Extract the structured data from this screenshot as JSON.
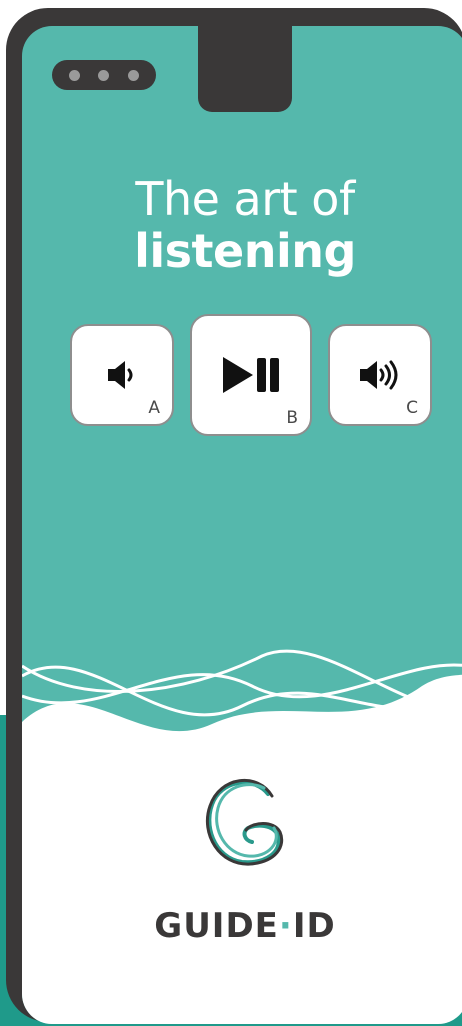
{
  "headline": {
    "line1": "The art of",
    "line2": "listening"
  },
  "controls": [
    {
      "id": "A",
      "icon": "volume-low-icon",
      "letter": "A"
    },
    {
      "id": "B",
      "icon": "play-pause-icon",
      "letter": "B"
    },
    {
      "id": "C",
      "icon": "volume-high-icon",
      "letter": "C"
    }
  ],
  "brand": {
    "name_left": "GUIDE",
    "separator": "·",
    "name_right": "ID"
  },
  "colors": {
    "screen": "#55b8ac",
    "device": "#3a3838",
    "accent": "#1f9a8a",
    "button_bg": "#ffffff"
  }
}
